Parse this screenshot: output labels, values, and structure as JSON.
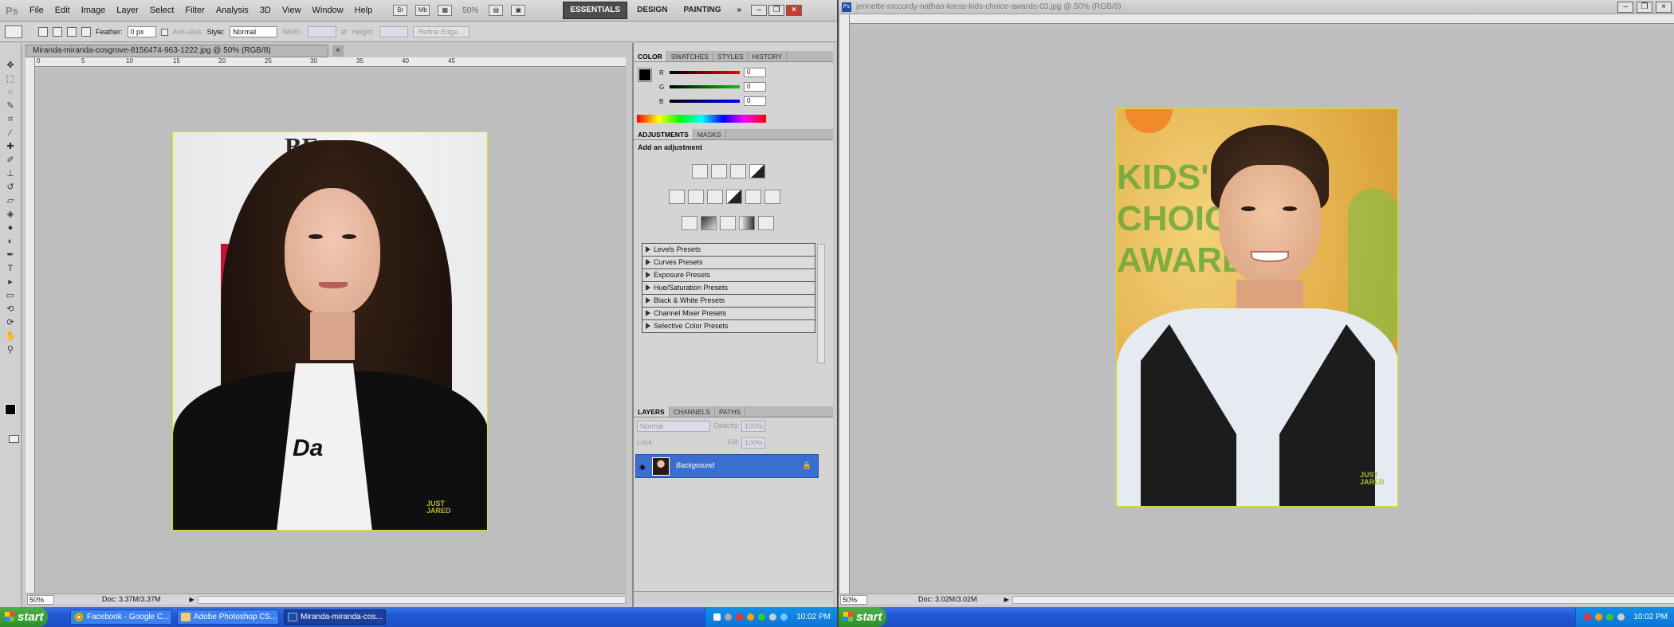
{
  "left": {
    "logo": "Ps",
    "menus": [
      "File",
      "Edit",
      "Image",
      "Layer",
      "Select",
      "Filter",
      "Analysis",
      "3D",
      "View",
      "Window",
      "Help"
    ],
    "zoom_readout": "50%",
    "workspaces": [
      "ESSENTIALS",
      "DESIGN",
      "PAINTING"
    ],
    "more": "»",
    "options": {
      "feather_label": "Feather:",
      "feather_value": "0 px",
      "antialias_label": "Anti-alias",
      "style_label": "Style:",
      "style_value": "Normal",
      "width_label": "Width:",
      "height_label": "Height:",
      "refine_edge": "Refine Edge..."
    },
    "document": {
      "tab_title": "Miranda-miranda-cosgrove-8156474-963-1222.jpg @ 50% (RGB/8)",
      "close_glyph": "×",
      "ruler_labels": [
        "0",
        "5",
        "10",
        "15",
        "20",
        "25",
        "30",
        "35",
        "40",
        "45"
      ],
      "status_zoom": "50%",
      "status_doc": "Doc: 3.37M/3.37M",
      "watermark": "JUST JARED"
    },
    "color_panel": {
      "tabs": [
        "COLOR",
        "SWATCHES",
        "STYLES",
        "HISTORY"
      ],
      "channels": [
        {
          "label": "R",
          "value": "0"
        },
        {
          "label": "G",
          "value": "0"
        },
        {
          "label": "B",
          "value": "0"
        }
      ]
    },
    "adjustments_panel": {
      "tabs": [
        "ADJUSTMENTS",
        "MASKS"
      ],
      "heading": "Add an adjustment",
      "presets": [
        "Levels Presets",
        "Curves Presets",
        "Exposure Presets",
        "Hue/Saturation Presets",
        "Black & White Presets",
        "Channel Mixer Presets",
        "Selective Color Presets"
      ]
    },
    "layers_panel": {
      "tabs": [
        "LAYERS",
        "CHANNELS",
        "PATHS"
      ],
      "blend_mode": "Normal",
      "opacity_label": "Opacity:",
      "opacity_value": "100%",
      "lock_label": "Lock:",
      "fill_label": "Fill:",
      "fill_value": "100%",
      "layer_name": "Background"
    },
    "taskbar": {
      "start": "start",
      "items": [
        "Facebook - Google C...",
        "Adobe Photoshop CS...",
        "Miranda-miranda-cos..."
      ],
      "clock": "10:02 PM"
    }
  },
  "right": {
    "title": "jennette-mccurdy-nathan-kress-kids-choice-awards-03.jpg @ 50% (RGB/8)",
    "status_zoom": "50%",
    "status_doc": "Doc: 3.02M/3.02M",
    "watermark": "JUST JARED",
    "background_text": "KIDS' CHOICE AWARDS",
    "taskbar": {
      "start": "start",
      "clock": "10:02 PM"
    }
  },
  "colors": {
    "accent_selected": "#3a6fd0",
    "image_border": "#e6e000",
    "taskbar_blue": "#2159d6"
  }
}
